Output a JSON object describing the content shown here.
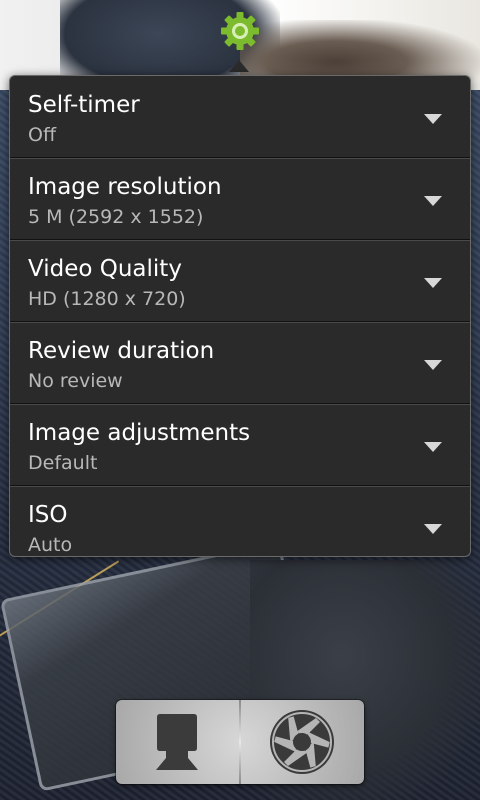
{
  "settings_popup": {
    "items": [
      {
        "label": "Self-timer",
        "value": "Off"
      },
      {
        "label": "Image resolution",
        "value": "5 M (2592 x 1552)"
      },
      {
        "label": "Video Quality",
        "value": "HD (1280 x 720)"
      },
      {
        "label": "Review duration",
        "value": "No review"
      },
      {
        "label": "Image adjustments",
        "value": "Default"
      },
      {
        "label": "ISO",
        "value": "Auto"
      }
    ]
  },
  "icons": {
    "settings": "gear-icon",
    "dropdown": "chevron-down-icon",
    "mode_switch": "camera-mode-icon",
    "shutter": "aperture-icon"
  },
  "colors": {
    "accent_green": "#7dbb2e",
    "popup_bg": "#2a2a2a",
    "title_text": "#ffffff",
    "value_text": "#b8b8b8"
  }
}
